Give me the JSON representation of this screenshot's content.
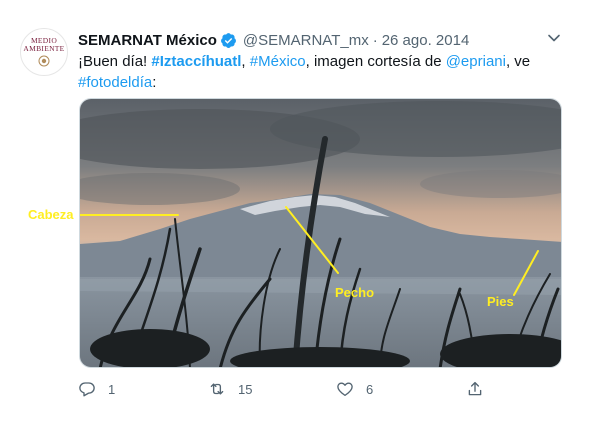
{
  "account": {
    "name": "SEMARNAT México",
    "handle": "@SEMARNAT_mx",
    "separator": "·",
    "date": "26 ago. 2014",
    "avatar_line1": "MEDIO",
    "avatar_line2": "AMBIENTE"
  },
  "tweet": {
    "text_intro": "¡Buen día! ",
    "hashtag_1": "#Iztaccíhuatl",
    "comma_1": ", ",
    "hashtag_2": "#México",
    "text_mid": ", imagen cortesía de ",
    "mention": "@epriani",
    "text_end": ", ve",
    "hashtag_3": "#fotodeldía",
    "text_colon": ":"
  },
  "media": {
    "annotations": {
      "cabeza": "Cabeza",
      "pecho": "Pecho",
      "pies": "Pies"
    },
    "annotation_color": "#ffee22"
  },
  "actions": {
    "reply_count": "1",
    "retweet_count": "15",
    "like_count": "6"
  },
  "colors": {
    "link": "#1d9bf0",
    "verified": "#1d9bf0",
    "muted": "#536471"
  },
  "icons": [
    "verified-badge-icon",
    "more-caret-icon",
    "reply-icon",
    "retweet-icon",
    "like-icon",
    "share-icon"
  ]
}
